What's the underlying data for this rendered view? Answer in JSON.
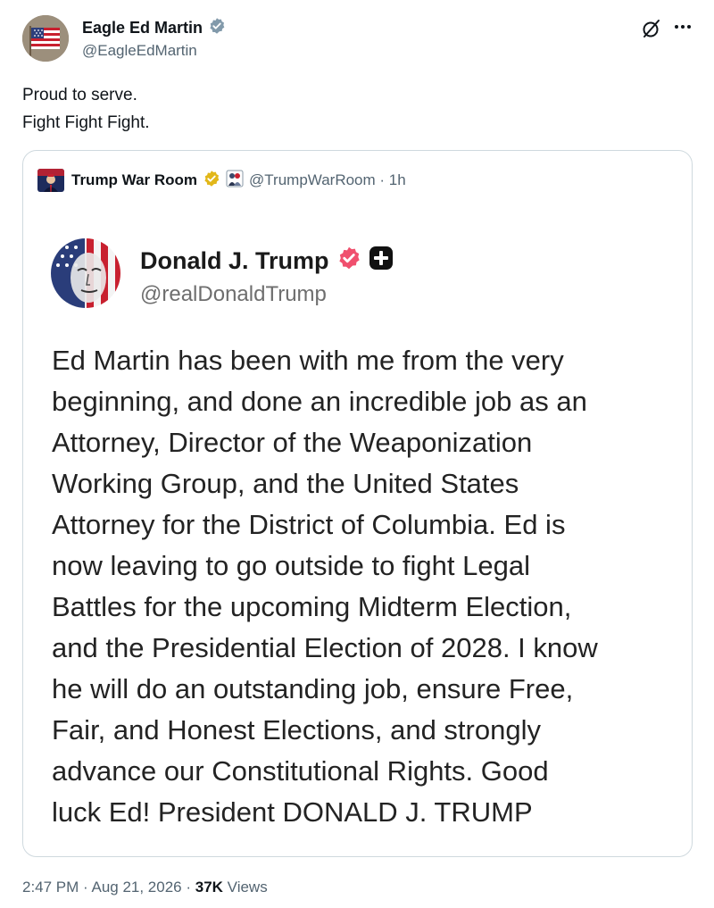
{
  "author": {
    "name": "Eagle Ed Martin",
    "handle": "@EagleEdMartin",
    "verified_color": "#829aab"
  },
  "post": {
    "lines": [
      "Proud to serve.",
      "Fight Fight Fight."
    ]
  },
  "quote": {
    "name": "Trump War Room",
    "handle_time": "@TrumpWarRoom · 1h",
    "verified_color": "#e2b719"
  },
  "embedded_post": {
    "name": "Donald J. Trump",
    "handle": "@realDonaldTrump",
    "verified_color": "#f0506e",
    "lines": [
      "Ed Martin has been with me from the very",
      "beginning, and done an incredible job as an",
      "Attorney, Director of the Weaponization",
      "Working Group, and the United States",
      "Attorney for the District of Columbia. Ed is",
      "now leaving to go outside to fight Legal",
      "Battles for the upcoming Midterm Election,",
      "and the Presidential Election of 2028. I know",
      "he will do an outstanding job, ensure Free,",
      "Fair, and Honest Elections, and strongly",
      "advance our Constitutional Rights. Good",
      "luck Ed! President DONALD J. TRUMP"
    ]
  },
  "meta": {
    "time": "2:47 PM",
    "sep1": " · ",
    "date": "Aug 21, 2026",
    "sep2": " · ",
    "views_count": "37K",
    "views_label": " Views"
  }
}
